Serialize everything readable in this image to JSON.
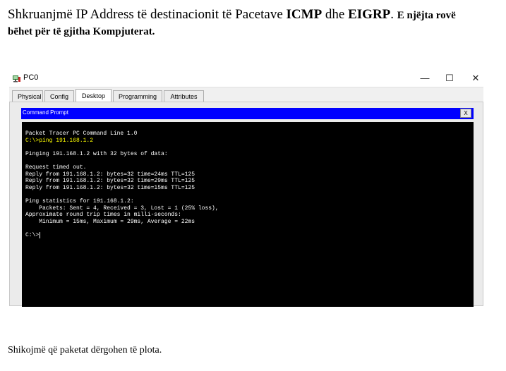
{
  "document": {
    "heading_part1": "Shkruanjmë IP Address të destinacionit të Pacetave",
    "heading_icmp": "ICMP",
    "heading_dhe": "dhe",
    "heading_eigrp": "EIGRP",
    "heading_dot": ".",
    "heading_part2": "E njëjta rovë",
    "heading_line2": "bëhet për të gjitha Kompjuterat.",
    "bottom_text": "Shikojmë që paketat dërgohen të plota."
  },
  "window": {
    "title": "PC0",
    "app_icon": "packet-tracer-pc-icon",
    "minimize_glyph": "—",
    "maximize_glyph": "☐",
    "close_glyph": "✕",
    "tabs": [
      {
        "label": "Physical",
        "active": false
      },
      {
        "label": "Config",
        "active": false
      },
      {
        "label": "Desktop",
        "active": true
      },
      {
        "label": "Programming",
        "active": false
      },
      {
        "label": "Attributes",
        "active": false
      }
    ]
  },
  "command_prompt": {
    "title": "Command Prompt",
    "close_label": "X",
    "bar_color": "#0000ff",
    "lines": [
      {
        "text": "Packet Tracer PC Command Line 1.0",
        "kind": "out"
      },
      {
        "text": "C:\\>ping 191.168.1.2",
        "kind": "cmd"
      },
      {
        "text": "",
        "kind": "blank"
      },
      {
        "text": "Pinging 191.168.1.2 with 32 bytes of data:",
        "kind": "out"
      },
      {
        "text": "",
        "kind": "blank"
      },
      {
        "text": "Request timed out.",
        "kind": "out"
      },
      {
        "text": "Reply from 191.168.1.2: bytes=32 time=24ms TTL=125",
        "kind": "out"
      },
      {
        "text": "Reply from 191.168.1.2: bytes=32 time=29ms TTL=125",
        "kind": "out"
      },
      {
        "text": "Reply from 191.168.1.2: bytes=32 time=15ms TTL=125",
        "kind": "out"
      },
      {
        "text": "",
        "kind": "blank"
      },
      {
        "text": "Ping statistics for 191.168.1.2:",
        "kind": "out"
      },
      {
        "text": "    Packets: Sent = 4, Received = 3, Lost = 1 (25% loss),",
        "kind": "out"
      },
      {
        "text": "Approximate round trip times in milli-seconds:",
        "kind": "out"
      },
      {
        "text": "    Minimum = 15ms, Maximum = 29ms, Average = 22ms",
        "kind": "out"
      },
      {
        "text": "",
        "kind": "blank"
      },
      {
        "text": "C:\\>",
        "kind": "prompt"
      }
    ]
  }
}
